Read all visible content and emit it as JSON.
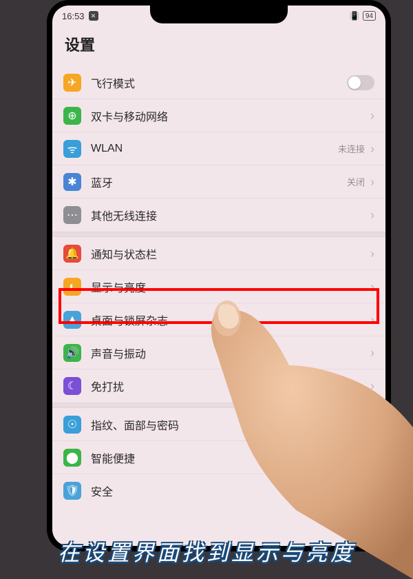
{
  "status": {
    "time": "16:53",
    "battery": "94"
  },
  "header": {
    "title": "设置"
  },
  "groups": [
    {
      "rows": [
        {
          "id": "airplane",
          "icon": "✈",
          "iconBg": "#f5a623",
          "label": "飞行模式",
          "ctrl": "toggle"
        },
        {
          "id": "sim",
          "icon": "⊕",
          "iconBg": "#3bb54a",
          "label": "双卡与移动网络",
          "ctrl": "chevron"
        },
        {
          "id": "wlan",
          "icon": "ᯤ",
          "iconBg": "#3a9ed8",
          "label": "WLAN",
          "value": "未连接",
          "ctrl": "chevron"
        },
        {
          "id": "bluetooth",
          "icon": "✱",
          "iconBg": "#4a84d6",
          "label": "蓝牙",
          "value": "关闭",
          "ctrl": "chevron"
        },
        {
          "id": "more-conn",
          "icon": "⋯",
          "iconBg": "#8e8e93",
          "label": "其他无线连接",
          "ctrl": "chevron"
        }
      ]
    },
    {
      "rows": [
        {
          "id": "notif",
          "icon": "🔔",
          "iconBg": "#e64b3c",
          "label": "通知与状态栏",
          "ctrl": "chevron"
        },
        {
          "id": "display",
          "icon": "◐",
          "iconBg": "#f5a623",
          "label": "显示与亮度",
          "ctrl": "chevron",
          "highlight": true
        },
        {
          "id": "desktop",
          "icon": "▲",
          "iconBg": "#4aa3d8",
          "label": "桌面与锁屏杂志",
          "ctrl": "chevron"
        },
        {
          "id": "sound",
          "icon": "🔊",
          "iconBg": "#3bb54a",
          "label": "声音与振动",
          "ctrl": "chevron"
        },
        {
          "id": "dnd",
          "icon": "☾",
          "iconBg": "#7b4fd6",
          "label": "免打扰",
          "ctrl": "chevron"
        }
      ]
    },
    {
      "rows": [
        {
          "id": "biometric",
          "icon": "☉",
          "iconBg": "#3a9ed8",
          "label": "指纹、面部与密码",
          "ctrl": "chevron"
        },
        {
          "id": "smart",
          "icon": "⬤",
          "iconBg": "#3bb54a",
          "label": "智能便捷",
          "ctrl": "chevron"
        },
        {
          "id": "security",
          "icon": "🛡",
          "iconBg": "#4aa3d8",
          "label": "安全",
          "ctrl": "chevron"
        }
      ]
    }
  ],
  "caption": "在设置界面找到显示与亮度"
}
